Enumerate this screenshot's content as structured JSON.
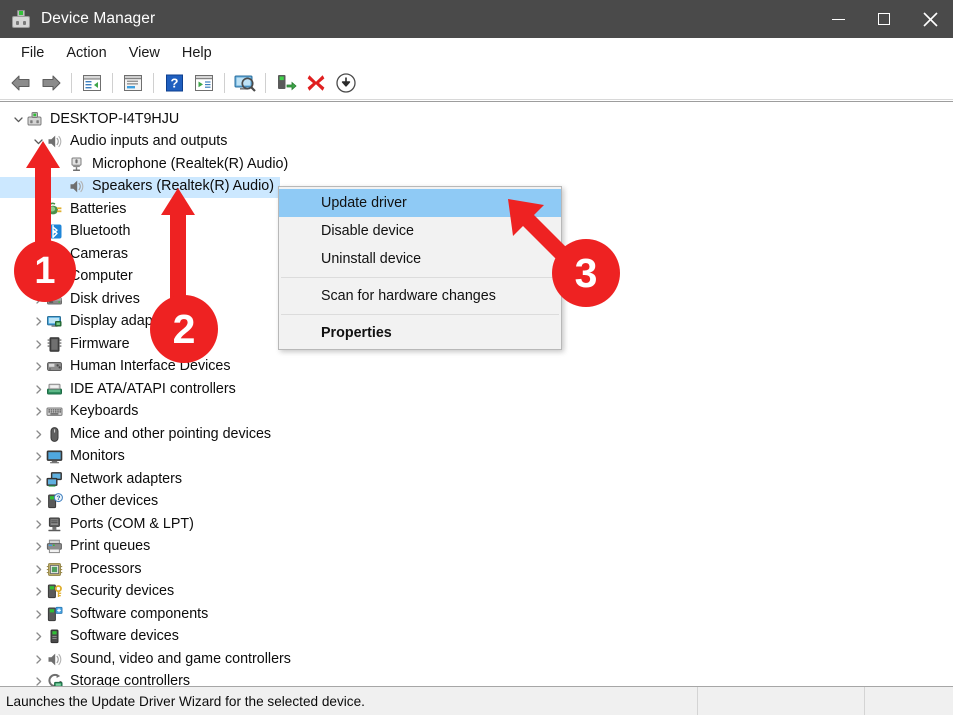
{
  "window": {
    "title": "Device Manager",
    "icon": "device-manager-icon",
    "buttons": {
      "minimize": "minimize-button",
      "maximize": "maximize-button",
      "close": "close-button"
    }
  },
  "menubar": {
    "items": [
      {
        "label": "File"
      },
      {
        "label": "Action"
      },
      {
        "label": "View"
      },
      {
        "label": "Help"
      }
    ]
  },
  "toolbar": {
    "buttons": [
      {
        "name": "back-icon",
        "tooltip": "Back"
      },
      {
        "name": "forward-icon",
        "tooltip": "Forward"
      },
      {
        "name": "show-hide-console-tree-icon",
        "tooltip": "Show/Hide Console Tree"
      },
      {
        "name": "properties-icon",
        "tooltip": "Properties"
      },
      {
        "name": "help-icon",
        "tooltip": "Help"
      },
      {
        "name": "update-driver-icon",
        "tooltip": "Update Driver"
      },
      {
        "name": "scan-for-hardware-changes-icon",
        "tooltip": "Scan for hardware changes"
      },
      {
        "name": "enable-device-icon",
        "tooltip": "Enable device"
      },
      {
        "name": "uninstall-device-icon",
        "tooltip": "Uninstall device"
      },
      {
        "name": "disable-device-icon",
        "tooltip": "Disable device"
      }
    ]
  },
  "tree": {
    "root": {
      "label": "DESKTOP-I4T9HJU",
      "icon": "computer-icon",
      "expanded": true,
      "level": 0
    },
    "nodes": [
      {
        "label": "Audio inputs and outputs",
        "icon": "speaker-icon",
        "level": 1,
        "expanded": true,
        "hasChildren": true,
        "selected": false
      },
      {
        "label": "Microphone (Realtek(R) Audio)",
        "icon": "microphone-icon",
        "level": 2,
        "expanded": false,
        "hasChildren": false,
        "selected": false
      },
      {
        "label": "Speakers (Realtek(R) Audio)",
        "icon": "speaker-icon",
        "level": 2,
        "expanded": false,
        "hasChildren": false,
        "selected": true
      },
      {
        "label": "Batteries",
        "icon": "battery-icon",
        "level": 1,
        "expanded": false,
        "hasChildren": true,
        "selected": false
      },
      {
        "label": "Bluetooth",
        "icon": "bluetooth-icon",
        "level": 1,
        "expanded": false,
        "hasChildren": true,
        "selected": false
      },
      {
        "label": "Cameras",
        "icon": "camera-icon",
        "level": 1,
        "expanded": false,
        "hasChildren": true,
        "selected": false
      },
      {
        "label": "Computer",
        "icon": "computer-icon",
        "level": 1,
        "expanded": false,
        "hasChildren": true,
        "selected": false
      },
      {
        "label": "Disk drives",
        "icon": "disk-drive-icon",
        "level": 1,
        "expanded": false,
        "hasChildren": true,
        "selected": false
      },
      {
        "label": "Display adapters",
        "icon": "display-adapter-icon",
        "level": 1,
        "expanded": false,
        "hasChildren": true,
        "selected": false
      },
      {
        "label": "Firmware",
        "icon": "firmware-icon",
        "level": 1,
        "expanded": false,
        "hasChildren": true,
        "selected": false
      },
      {
        "label": "Human Interface Devices",
        "icon": "human-interface-device-icon",
        "level": 1,
        "expanded": false,
        "hasChildren": true,
        "selected": false
      },
      {
        "label": "IDE ATA/ATAPI controllers",
        "icon": "ide-controller-icon",
        "level": 1,
        "expanded": false,
        "hasChildren": true,
        "selected": false
      },
      {
        "label": "Keyboards",
        "icon": "keyboard-icon",
        "level": 1,
        "expanded": false,
        "hasChildren": true,
        "selected": false
      },
      {
        "label": "Mice and other pointing devices",
        "icon": "mouse-icon",
        "level": 1,
        "expanded": false,
        "hasChildren": true,
        "selected": false
      },
      {
        "label": "Monitors",
        "icon": "monitor-icon",
        "level": 1,
        "expanded": false,
        "hasChildren": true,
        "selected": false
      },
      {
        "label": "Network adapters",
        "icon": "network-adapter-icon",
        "level": 1,
        "expanded": false,
        "hasChildren": true,
        "selected": false
      },
      {
        "label": "Other devices",
        "icon": "other-device-icon",
        "level": 1,
        "expanded": false,
        "hasChildren": true,
        "selected": false
      },
      {
        "label": "Ports (COM & LPT)",
        "icon": "port-icon",
        "level": 1,
        "expanded": false,
        "hasChildren": true,
        "selected": false
      },
      {
        "label": "Print queues",
        "icon": "printer-icon",
        "level": 1,
        "expanded": false,
        "hasChildren": true,
        "selected": false
      },
      {
        "label": "Processors",
        "icon": "processor-icon",
        "level": 1,
        "expanded": false,
        "hasChildren": true,
        "selected": false
      },
      {
        "label": "Security devices",
        "icon": "security-device-icon",
        "level": 1,
        "expanded": false,
        "hasChildren": true,
        "selected": false
      },
      {
        "label": "Software components",
        "icon": "software-component-icon",
        "level": 1,
        "expanded": false,
        "hasChildren": true,
        "selected": false
      },
      {
        "label": "Software devices",
        "icon": "software-device-icon",
        "level": 1,
        "expanded": false,
        "hasChildren": true,
        "selected": false
      },
      {
        "label": "Sound, video and game controllers",
        "icon": "speaker-icon",
        "level": 1,
        "expanded": false,
        "hasChildren": true,
        "selected": false
      },
      {
        "label": "Storage controllers",
        "icon": "storage-controller-icon",
        "level": 1,
        "expanded": false,
        "hasChildren": true,
        "selected": false
      }
    ]
  },
  "context_menu": {
    "items": [
      {
        "label": "Update driver",
        "highlighted": true,
        "bold": false,
        "separator_after": false
      },
      {
        "label": "Disable device",
        "highlighted": false,
        "bold": false,
        "separator_after": false
      },
      {
        "label": "Uninstall device",
        "highlighted": false,
        "bold": false,
        "separator_after": true
      },
      {
        "label": "Scan for hardware changes",
        "highlighted": false,
        "bold": false,
        "separator_after": true
      },
      {
        "label": "Properties",
        "highlighted": false,
        "bold": true,
        "separator_after": false
      }
    ]
  },
  "statusbar": {
    "message": "Launches the Update Driver Wizard for the selected device.",
    "pane2": "",
    "pane3": ""
  },
  "annotations": {
    "accent_color": "#ee2222",
    "badges": [
      {
        "number": "1",
        "target": "audio-inputs-expand-chevron"
      },
      {
        "number": "2",
        "target": "speakers-device-row"
      },
      {
        "number": "3",
        "target": "context-menu-update-driver"
      }
    ]
  },
  "colors": {
    "titlebar_bg": "#4a4a4a",
    "selection_bg": "#cce8ff",
    "menu_highlight_bg": "#8fcaf5",
    "statusbar_bg": "#f0f0f0",
    "annotation_red": "#ee2222"
  }
}
